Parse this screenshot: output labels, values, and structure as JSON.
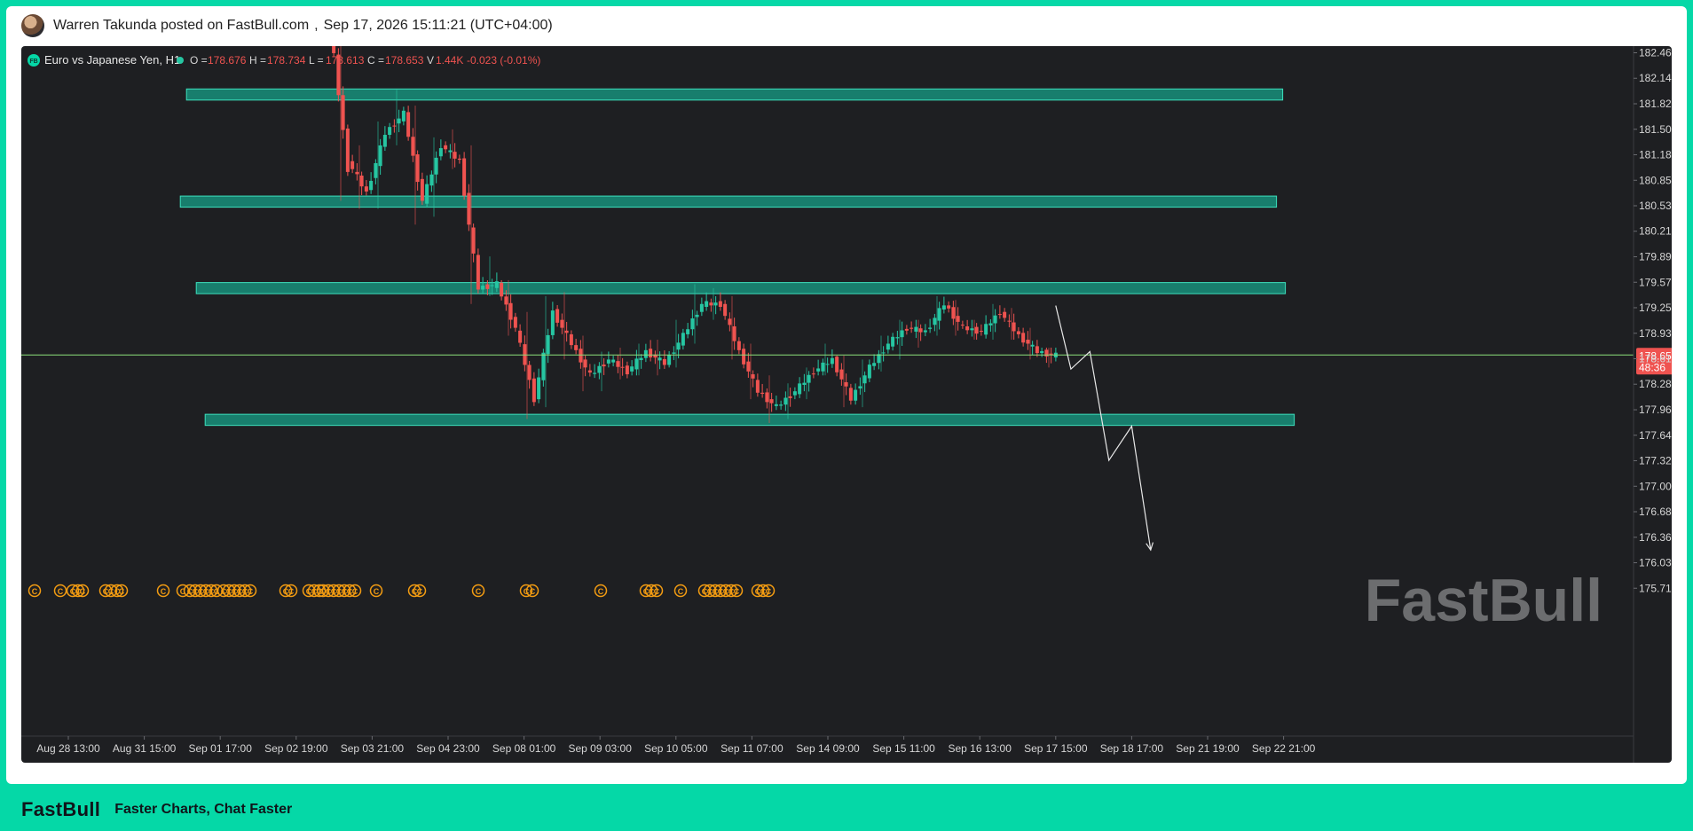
{
  "post": {
    "author_line": "Warren Takunda posted on FastBull.com",
    "sep": ",",
    "timestamp": "Sep 17, 2026 15:11:21 (UTC+04:00)"
  },
  "legend": {
    "badge": "FB",
    "symbol": "Euro vs Japanese Yen, H1",
    "o_label": "O =",
    "o_val": "178.676",
    "h_label": "H =",
    "h_val": "178.734",
    "l_label": "L =",
    "l_val": "178.613",
    "c_label": "C =",
    "c_val": "178.653",
    "v_label": "V",
    "v_val": "1.44K",
    "change": "-0.023 (-0.01%)"
  },
  "price_tag": {
    "price": "178.657",
    "countdown": "48:36"
  },
  "watermark": "FastBull",
  "footer": {
    "logo": "FastBull",
    "tagline": "Faster Charts, Chat Faster"
  },
  "colors": {
    "background": "#1e1f22",
    "up": "#26c6a2",
    "down": "#ef5350",
    "zone_fill": "#178f7a",
    "zone_border": "#3de0bd",
    "current_line": "#8be07a",
    "event_icon": "#f39c12",
    "brand": "#05d8a7"
  },
  "chart_data": {
    "type": "candlestick",
    "title": "Euro vs Japanese Yen, H1",
    "y_ticks": [
      182.466,
      182.145,
      181.824,
      181.502,
      181.181,
      180.859,
      180.538,
      180.217,
      179.895,
      179.574,
      179.253,
      178.931,
      178.61,
      178.289,
      177.967,
      177.646,
      177.325,
      177.003,
      176.682,
      176.36,
      176.039,
      175.718
    ],
    "y_tick_labels": [
      "182.466",
      "182.145",
      "181.824",
      "181.502",
      "181.181",
      "180.859",
      "180.538",
      "180.217",
      "179.895",
      "179.574",
      "179.253",
      "178.931",
      "178.610",
      "178.289",
      "177.967",
      "177.646",
      "177.325",
      "177.003",
      "176.682",
      "176.360",
      "176.039",
      "175.718"
    ],
    "x_tick_labels": [
      "Aug 28 13:00",
      "Aug 31 15:00",
      "Sep 01 17:00",
      "Sep 02 19:00",
      "Sep 03 21:00",
      "Sep 04 23:00",
      "Sep 08 01:00",
      "Sep 09 03:00",
      "Sep 10 05:00",
      "Sep 11 07:00",
      "Sep 14 09:00",
      "Sep 15 11:00",
      "Sep 16 13:00",
      "Sep 17 15:00",
      "Sep 18 17:00",
      "Sep 21 19:00",
      "Sep 22 21:00"
    ],
    "ylim": [
      175.5,
      182.58
    ],
    "current_price": 178.657,
    "zones": [
      {
        "from": 181.87,
        "to": 182.01,
        "start": "Sep 01 17:00",
        "end": "Sep 22 21:00"
      },
      {
        "from": 180.52,
        "to": 180.66,
        "start": "Sep 01 17:00",
        "end": "Sep 22 21:00"
      },
      {
        "from": 179.43,
        "to": 179.57,
        "start": "Sep 01 17:00",
        "end": "Sep 22 21:00"
      },
      {
        "from": 177.77,
        "to": 177.91,
        "start": "Sep 01 17:00",
        "end": "Sep 22 21:00"
      }
    ],
    "projection_path": [
      {
        "x": 13.0,
        "y": 179.28
      },
      {
        "x": 13.2,
        "y": 178.48
      },
      {
        "x": 13.45,
        "y": 178.7
      },
      {
        "x": 13.7,
        "y": 177.33
      },
      {
        "x": 14.0,
        "y": 177.76
      },
      {
        "x": 14.25,
        "y": 176.2
      }
    ],
    "ohlc": [
      [
        182.9,
        182.8,
        180.6,
        181.0
      ],
      [
        181.1,
        181.3,
        180.5,
        180.7
      ],
      [
        180.7,
        181.6,
        180.5,
        181.45
      ],
      [
        181.45,
        182.0,
        181.3,
        181.7
      ],
      [
        181.7,
        181.8,
        180.3,
        180.6
      ],
      [
        180.6,
        181.4,
        180.4,
        181.3
      ],
      [
        181.3,
        181.5,
        181.0,
        181.1
      ],
      [
        181.1,
        181.3,
        179.3,
        179.5
      ],
      [
        179.5,
        179.9,
        179.4,
        179.55
      ],
      [
        179.55,
        179.6,
        178.9,
        179.0
      ],
      [
        179.0,
        179.2,
        177.85,
        178.1
      ],
      [
        178.1,
        179.4,
        178.0,
        179.2
      ],
      [
        179.2,
        179.45,
        178.6,
        178.8
      ],
      [
        178.8,
        178.9,
        178.2,
        178.4
      ],
      [
        178.4,
        178.7,
        178.2,
        178.6
      ],
      [
        178.6,
        178.75,
        178.35,
        178.45
      ],
      [
        178.45,
        178.8,
        178.4,
        178.7
      ],
      [
        178.7,
        178.85,
        178.4,
        178.55
      ],
      [
        178.55,
        179.1,
        178.5,
        178.9
      ],
      [
        178.9,
        179.55,
        178.8,
        179.3
      ],
      [
        179.3,
        179.5,
        179.1,
        179.3
      ],
      [
        179.3,
        179.4,
        178.6,
        178.7
      ],
      [
        178.7,
        178.8,
        178.1,
        178.2
      ],
      [
        178.2,
        178.4,
        177.8,
        178.0
      ],
      [
        178.0,
        178.3,
        177.85,
        178.2
      ],
      [
        178.2,
        178.5,
        178.1,
        178.45
      ],
      [
        178.45,
        178.8,
        178.4,
        178.6
      ],
      [
        178.6,
        178.65,
        178.0,
        178.1
      ],
      [
        178.1,
        178.6,
        178.0,
        178.5
      ],
      [
        178.5,
        178.9,
        178.45,
        178.8
      ],
      [
        178.8,
        179.1,
        178.6,
        179.0
      ],
      [
        179.0,
        179.1,
        178.75,
        178.95
      ],
      [
        178.95,
        179.4,
        178.9,
        179.3
      ],
      [
        179.3,
        179.35,
        178.9,
        179.0
      ],
      [
        179.0,
        179.1,
        178.85,
        178.95
      ],
      [
        178.95,
        179.3,
        178.85,
        179.2
      ],
      [
        179.2,
        179.25,
        178.85,
        178.9
      ],
      [
        178.9,
        179.0,
        178.6,
        178.7
      ],
      [
        178.7,
        178.75,
        178.5,
        178.65
      ]
    ],
    "events": {
      "marker": "C",
      "count": 56
    }
  }
}
